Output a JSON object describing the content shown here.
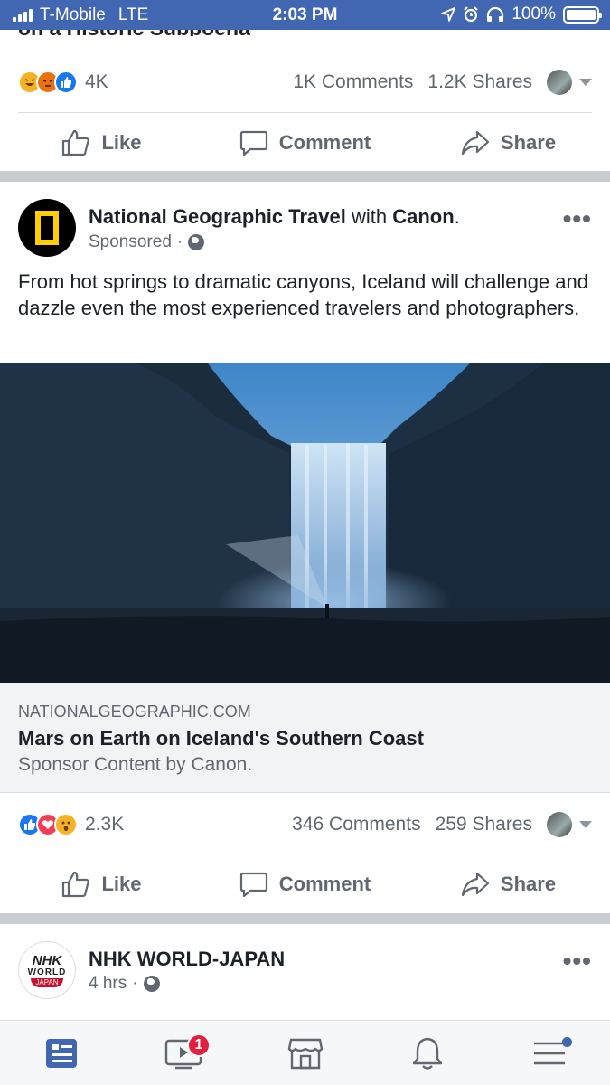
{
  "status_bar": {
    "carrier": "T-Mobile",
    "network": "LTE",
    "time": "2:03 PM",
    "battery": "100%"
  },
  "previous_post": {
    "title_fragment": "on a Historic Subpoena",
    "reaction_count": "4K",
    "comments": "1K Comments",
    "shares": "1.2K Shares"
  },
  "actions": {
    "like": "Like",
    "comment": "Comment",
    "share": "Share"
  },
  "sponsored_post": {
    "page_name": "National Geographic Travel",
    "with_text": "with",
    "partner": "Canon",
    "period": ".",
    "sub": "Sponsored",
    "text": "From hot springs to dramatic canyons, Iceland will challenge and dazzle even the most experienced travelers and photographers.",
    "link_domain": "NATIONALGEOGRAPHIC.COM",
    "link_title": "Mars on Earth on Iceland's Southern Coast",
    "link_desc": "Sponsor Content by Canon.",
    "reaction_count": "2.3K",
    "comments": "346 Comments",
    "shares": "259 Shares"
  },
  "next_post": {
    "page_name": "NHK WORLD-JAPAN",
    "time": "4 hrs",
    "logo_text_top": "NHK",
    "logo_text_mid": "WORLD",
    "logo_text_bot": "JAPAN"
  },
  "tab_bar": {
    "video_badge": "1",
    "icons": [
      "news-feed-icon",
      "watch-icon",
      "marketplace-icon",
      "notifications-icon",
      "menu-icon"
    ]
  },
  "colors": {
    "brand_blue": "#4267b2",
    "badge_red": "#e41e3f",
    "natgeo_yellow": "#ffce00"
  }
}
